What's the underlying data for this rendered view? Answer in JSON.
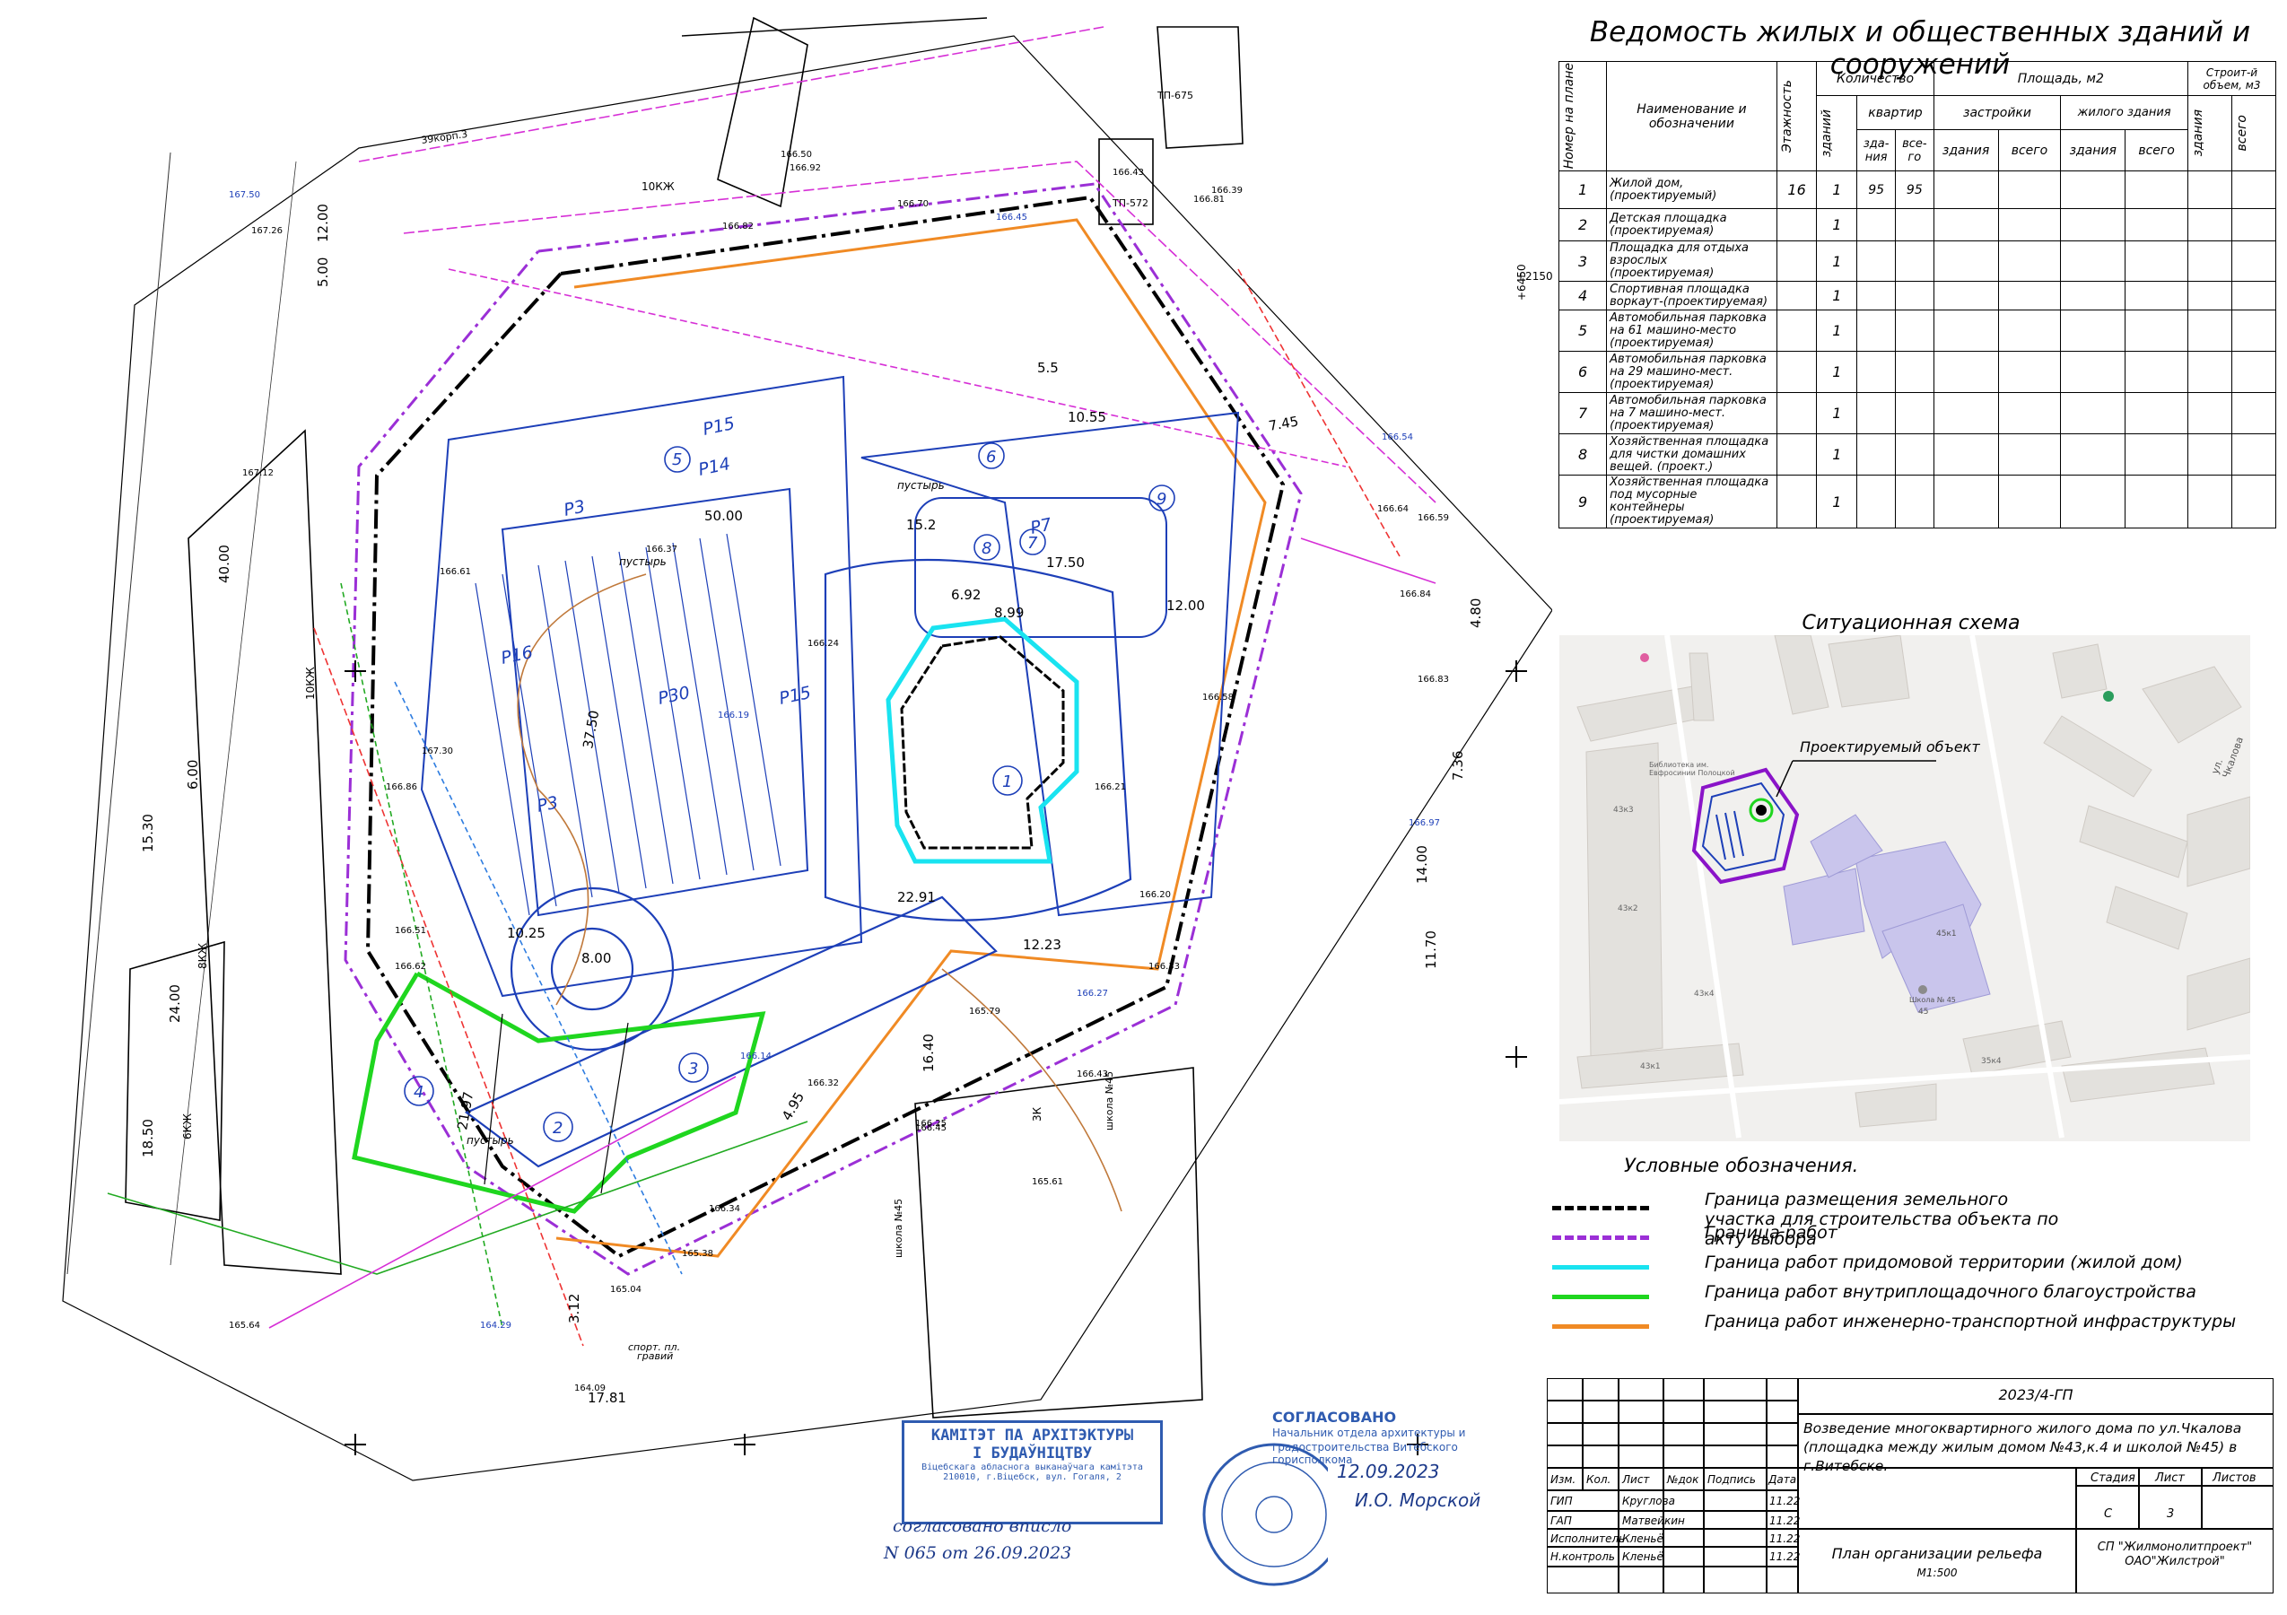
{
  "sheet": {
    "title": "Ведомость жилых и общественных зданий и сооружений"
  },
  "spec_table": {
    "headers": {
      "num": "Номер на плане",
      "name": "Наименование и обозначении",
      "floors": "Этажность",
      "quantity": "Количество",
      "q_buildings": "зданий",
      "q_apartments": "квартир",
      "q_apt_building": "зда-ния",
      "q_apt_total": "все-го",
      "area": "Площадь, м2",
      "area_built": "застройки",
      "area_built_building": "здания",
      "area_built_total": "всего",
      "area_living": "жилого здания",
      "area_living_building": "здания",
      "area_living_total": "всего",
      "volume": "Строит-й объем, м3",
      "vol_building": "здания",
      "vol_total": "всего"
    },
    "rows": [
      {
        "n": "1",
        "name": "Жилой дом, (проектируемый)",
        "floors": "16",
        "buildings": "1",
        "apt_building": "95",
        "apt_total": "95"
      },
      {
        "n": "2",
        "name": "Детская площадка (проектируемая)",
        "floors": "",
        "buildings": "1",
        "apt_building": "",
        "apt_total": ""
      },
      {
        "n": "3",
        "name": "Площадка для отдыха взрослых (проектируемая)",
        "floors": "",
        "buildings": "1",
        "apt_building": "",
        "apt_total": ""
      },
      {
        "n": "4",
        "name": "Спортивная площадка воркаут-(проектируемая)",
        "floors": "",
        "buildings": "1",
        "apt_building": "",
        "apt_total": ""
      },
      {
        "n": "5",
        "name": "Автомобильная парковка на 61 машино-место (проектируемая)",
        "floors": "",
        "buildings": "1",
        "apt_building": "",
        "apt_total": ""
      },
      {
        "n": "6",
        "name": "Автомобильная парковка на 29 машино-мест. (проектируемая)",
        "floors": "",
        "buildings": "1",
        "apt_building": "",
        "apt_total": ""
      },
      {
        "n": "7",
        "name": "Автомобильная парковка на 7 машино-мест. (проектируемая)",
        "floors": "",
        "buildings": "1",
        "apt_building": "",
        "apt_total": ""
      },
      {
        "n": "8",
        "name": "Хозяйственная площадка для чистки домашних вещей. (проект.)",
        "floors": "",
        "buildings": "1",
        "apt_building": "",
        "apt_total": ""
      },
      {
        "n": "9",
        "name": "Хозяйственная площадка под мусорные контейнеры (проектируемая)",
        "floors": "",
        "buildings": "1",
        "apt_building": "",
        "apt_total": ""
      }
    ]
  },
  "situation": {
    "title": "Ситуационная схема",
    "callout": "Проектируемый объект",
    "street": "ул. Чкалова",
    "library": "Библиотека им. Евфросинии Полоцкой",
    "school": "Школа № 45",
    "house_labels": [
      "43к3",
      "43к2",
      "43к1",
      "43к4",
      "45к1",
      "45",
      "35к4"
    ]
  },
  "legend": {
    "title": "Условные обозначения.",
    "items": [
      {
        "text": "Граница размещения земельного участка для строительства объекта по акту выбора",
        "color": "#000000",
        "style": "dashdot"
      },
      {
        "text": "Граница работ",
        "color": "#9b2fd6",
        "style": "dashdot"
      },
      {
        "text": "Граница работ придомовой территории (жилой дом)",
        "color": "#19e3f0",
        "style": "solid"
      },
      {
        "text": "Граница работ внутриплощадочного благоустройства",
        "color": "#1fd61f",
        "style": "solid"
      },
      {
        "text": "Граница работ инженерно-транспортной инфраструктуры",
        "color": "#f08a24",
        "style": "solid"
      }
    ]
  },
  "plan": {
    "elev_labels": [
      "166.50",
      "166.92",
      "166.82",
      "166.45",
      "166.70",
      "166.39",
      "166.81",
      "166.43",
      "166.54",
      "166.64",
      "166.59",
      "166.84",
      "166.83",
      "166.97",
      "166.58",
      "166.21",
      "166.20",
      "166.33",
      "166.27",
      "166.45",
      "166.32",
      "166.37",
      "166.24",
      "166.19",
      "166.61",
      "166.86",
      "166.51",
      "166.62",
      "167.50",
      "167.26",
      "167.12",
      "167.30",
      "165.64",
      "164.29",
      "164.09",
      "165.04",
      "165.38",
      "166.34",
      "166.14",
      "166.25",
      "165.61",
      "166.43",
      "165.79"
    ],
    "dims": [
      "12.00",
      "40.00",
      "24.00",
      "18.50",
      "15.30",
      "6.00",
      "37.50",
      "6.92",
      "8.99",
      "22.91",
      "12.23",
      "14.00",
      "11.70",
      "7.36",
      "4.80",
      "21.97",
      "10.25",
      "8.00",
      "17.81",
      "17.50",
      "15.2",
      "5.5",
      "10.55",
      "7.45",
      "50.00",
      "3.12",
      "4.95",
      "16.40",
      "12.00",
      "5.00"
    ],
    "parking_labels": [
      "P15",
      "P14",
      "P16",
      "P30",
      "P15",
      "P7",
      "P3",
      "P3"
    ],
    "site_numbers": [
      "1",
      "2",
      "3",
      "4",
      "5",
      "6",
      "7",
      "8",
      "9"
    ],
    "notes": {
      "tp1": "ТП-675",
      "tp2": "ТП-572",
      "ten_kzh1": "10КЖ",
      "ten_kzh2": "10КЖ",
      "six_kzh": "6КЖ",
      "eight_kzh": "8КЖ",
      "three_k": "3К",
      "school1": "школа №45",
      "school2": "школа №45",
      "pustyr1": "пустырь",
      "pustyr2": "пустырь",
      "pustyr3": "пустырь",
      "sport": "спорт. пл.",
      "gravel": "гравий",
      "plus2150": "+2150",
      "plus6450": "+6450",
      "addr": "39корп.3"
    }
  },
  "stamp_left": {
    "line1": "КАМІТЭТ ПА АРХІТЭКТУРЫ",
    "line2": "І БУДАЎНІЦТВУ",
    "line3": "Віцебскага абласнога выканаўчага камітэта",
    "line4": "210010, г.Віцебск, вул. Гогаля, 2",
    "hand1": "согласовано вписло",
    "hand2": "N 065 от 26.09.2023",
    "color": "#2f5bb0"
  },
  "stamp_right": {
    "line1": "СОГЛАСОВАНО",
    "line2": "Начальник отдела архитектуры и",
    "line3": "градостроительства Витебского горисполкома",
    "date": "12.09.2023",
    "sign": "И.О. Морской",
    "color": "#2f5bb0"
  },
  "title_block": {
    "code": "2023/4-ГП",
    "project": "Возведение многоквартирного жилого дома по ул.Чкалова (площадка между жилым домом №43,к.4 и школой №45) в г.Витебске.",
    "drawing": "План организации рельефа",
    "scale": "М1:500",
    "org": "СП \"Жилмонолитпроект\" ОАО\"Жилстрой\"",
    "col_headers": [
      "Изм.",
      "Кол.",
      "Лист",
      "№док",
      "Подпись",
      "Дата"
    ],
    "stage_label": "Стадия",
    "sheet_label": "Лист",
    "sheets_label": "Листов",
    "stage": "С",
    "sheet": "3",
    "people": [
      {
        "role": "ГИП",
        "name": "Круглова",
        "date": "11.22"
      },
      {
        "role": "ГАП",
        "name": "Матвейкин",
        "date": "11.22"
      },
      {
        "role": "Исполнитель",
        "name": "Кленьё",
        "date": "11.22"
      },
      {
        "role": "Н.контроль",
        "name": "Кленьё",
        "date": "11.22"
      }
    ]
  }
}
